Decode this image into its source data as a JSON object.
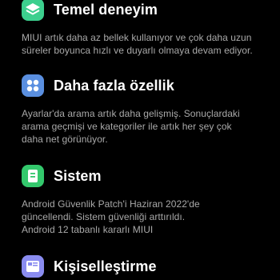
{
  "sections": [
    {
      "title": "Temel deneyim",
      "icon": "layers-icon",
      "icon_color": "#3ccf8e",
      "lines": [
        "MIUI artık daha az bellek kullanıyor ve çok daha uzun",
        "süreler boyunca hızlı ve duyarlı olmaya devam ediyor."
      ]
    },
    {
      "title": "Daha fazla özellik",
      "icon": "grid-apps-icon",
      "icon_color": "#5a8fe0",
      "lines": [
        "Ayarlar'da arama artık daha gelişmiş. Sonuçlardaki",
        "arama geçmişi ve kategoriler ile artık her şey çok",
        "daha net görünüyor."
      ]
    },
    {
      "title": "Sistem",
      "icon": "system-card-icon",
      "icon_color": "#33c86c",
      "lines": [
        "Android Güvenlik Patch'i Haziran 2022'de",
        "güncellendi. Sistem güvenliği arttırıldı.",
        "Android 12 tabanlı kararlı MIUI"
      ]
    },
    {
      "title": "Kişiselleştirme",
      "icon": "personalize-icon",
      "icon_color": "#8a8cf0",
      "lines": []
    }
  ]
}
